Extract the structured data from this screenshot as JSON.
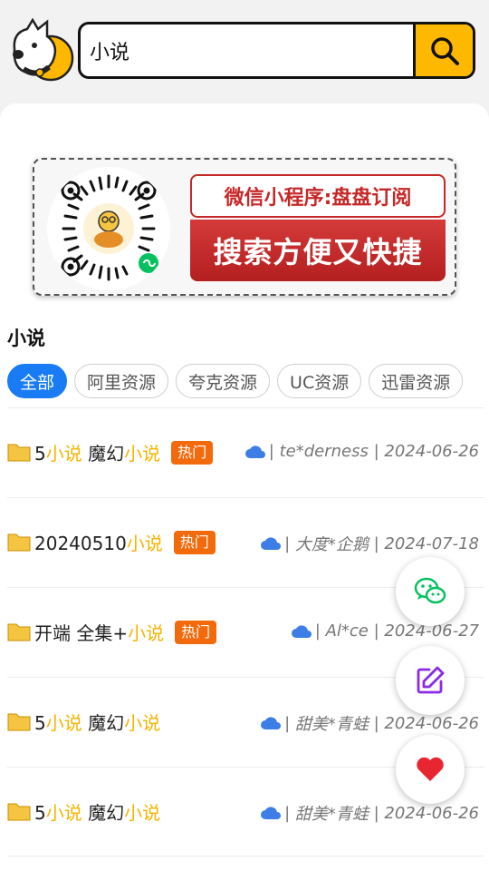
{
  "search": {
    "value": "小说"
  },
  "banner": {
    "line1": "微信小程序:盘盘订阅",
    "line2": "搜索方便又快捷"
  },
  "section_title": "小说",
  "tabs": [
    {
      "label": "全部",
      "active": true
    },
    {
      "label": "阿里资源",
      "active": false
    },
    {
      "label": "夸克资源",
      "active": false
    },
    {
      "label": "UC资源",
      "active": false
    },
    {
      "label": "迅雷资源",
      "active": false
    }
  ],
  "results": [
    {
      "title_parts": [
        "5",
        "小说",
        " 魔幻",
        "小说"
      ],
      "hot": "热门",
      "user": "te*derness",
      "date": "2024-06-26"
    },
    {
      "title_parts": [
        "20240510",
        "小说"
      ],
      "hot": "热门",
      "user": "大度*企鹅",
      "date": "2024-07-18"
    },
    {
      "title_parts": [
        "开端 全集+",
        "小说"
      ],
      "hot": "热门",
      "user": "Al*ce",
      "date": "2024-06-27"
    },
    {
      "title_parts": [
        "5",
        "小说",
        " 魔幻",
        "小说"
      ],
      "hot": "",
      "user": "甜美*青蛙",
      "date": "2024-06-26"
    },
    {
      "title_parts": [
        "5",
        "小说",
        " 魔幻",
        "小说"
      ],
      "hot": "",
      "user": "甜美*青蛙",
      "date": "2024-06-26"
    }
  ],
  "colors": {
    "accent": "#ffb800",
    "highlight": "#f5b400",
    "hot": "#f26a0c",
    "tab_active": "#1a7cf5",
    "heart": "#e8262f",
    "edit": "#8a2be2",
    "wechat": "#07c160"
  },
  "icons": {
    "fab1": "wechat-icon",
    "fab2": "edit-icon",
    "fab3": "heart-icon"
  }
}
